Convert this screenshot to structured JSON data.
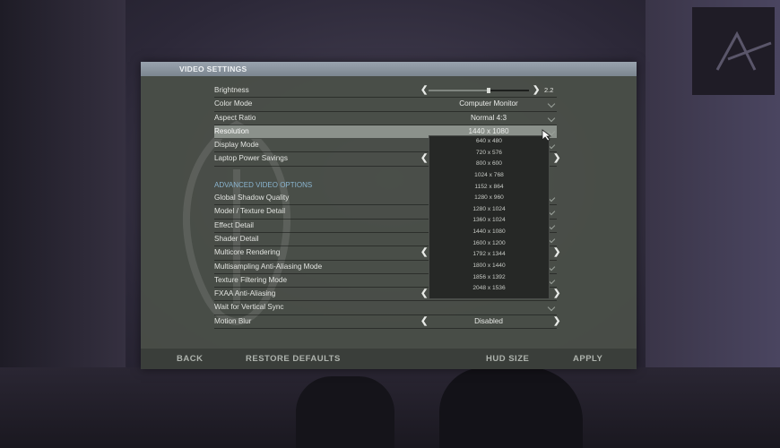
{
  "panel": {
    "title": "VIDEO SETTINGS"
  },
  "settings": [
    {
      "label": "Brightness",
      "type": "slider",
      "value": "2.2",
      "level": 0.6
    },
    {
      "label": "Color Mode",
      "type": "dropdown",
      "value": "Computer Monitor"
    },
    {
      "label": "Aspect Ratio",
      "type": "dropdown",
      "value": "Normal 4:3"
    },
    {
      "label": "Resolution",
      "type": "dropdown",
      "value": "1440 x 1080",
      "active": true
    },
    {
      "label": "Display Mode",
      "type": "dropdown",
      "value": ""
    },
    {
      "label": "Laptop Power Savings",
      "type": "toggle",
      "value": ""
    }
  ],
  "advanced": {
    "title": "ADVANCED VIDEO OPTIONS",
    "rows": [
      {
        "label": "Global Shadow Quality",
        "type": "dropdown",
        "value": ""
      },
      {
        "label": "Model / Texture Detail",
        "type": "dropdown",
        "value": ""
      },
      {
        "label": "Effect Detail",
        "type": "dropdown",
        "value": ""
      },
      {
        "label": "Shader Detail",
        "type": "dropdown",
        "value": ""
      },
      {
        "label": "Multicore Rendering",
        "type": "toggle",
        "value": ""
      },
      {
        "label": "Multisampling Anti-Aliasing Mode",
        "type": "dropdown",
        "value": ""
      },
      {
        "label": "Texture Filtering Mode",
        "type": "dropdown",
        "value": ""
      },
      {
        "label": "FXAA Anti-Aliasing",
        "type": "toggle",
        "value": ""
      },
      {
        "label": "Wait for Vertical Sync",
        "type": "dropdown",
        "value": ""
      },
      {
        "label": "Motion Blur",
        "type": "toggle",
        "value": "Disabled"
      }
    ]
  },
  "resolution_options": [
    "640 x 480",
    "720 x 576",
    "800 x 600",
    "1024 x 768",
    "1152 x 864",
    "1280 x 960",
    "1280 x 1024",
    "1360 x 1024",
    "1440 x 1080",
    "1600 x 1200",
    "1792 x 1344",
    "1800 x 1440",
    "1856 x 1392",
    "2048 x 1536"
  ],
  "footer": {
    "back": "BACK",
    "restore": "RESTORE DEFAULTS",
    "hud_size": "HUD SIZE",
    "apply": "APPLY"
  },
  "icons": {
    "arrow_left": "❮",
    "arrow_right": "❯"
  },
  "colors": {
    "header": "#8e98a2",
    "panel": "#4a5048",
    "section": "#8ab4cf",
    "active_row": "#8b918b"
  }
}
